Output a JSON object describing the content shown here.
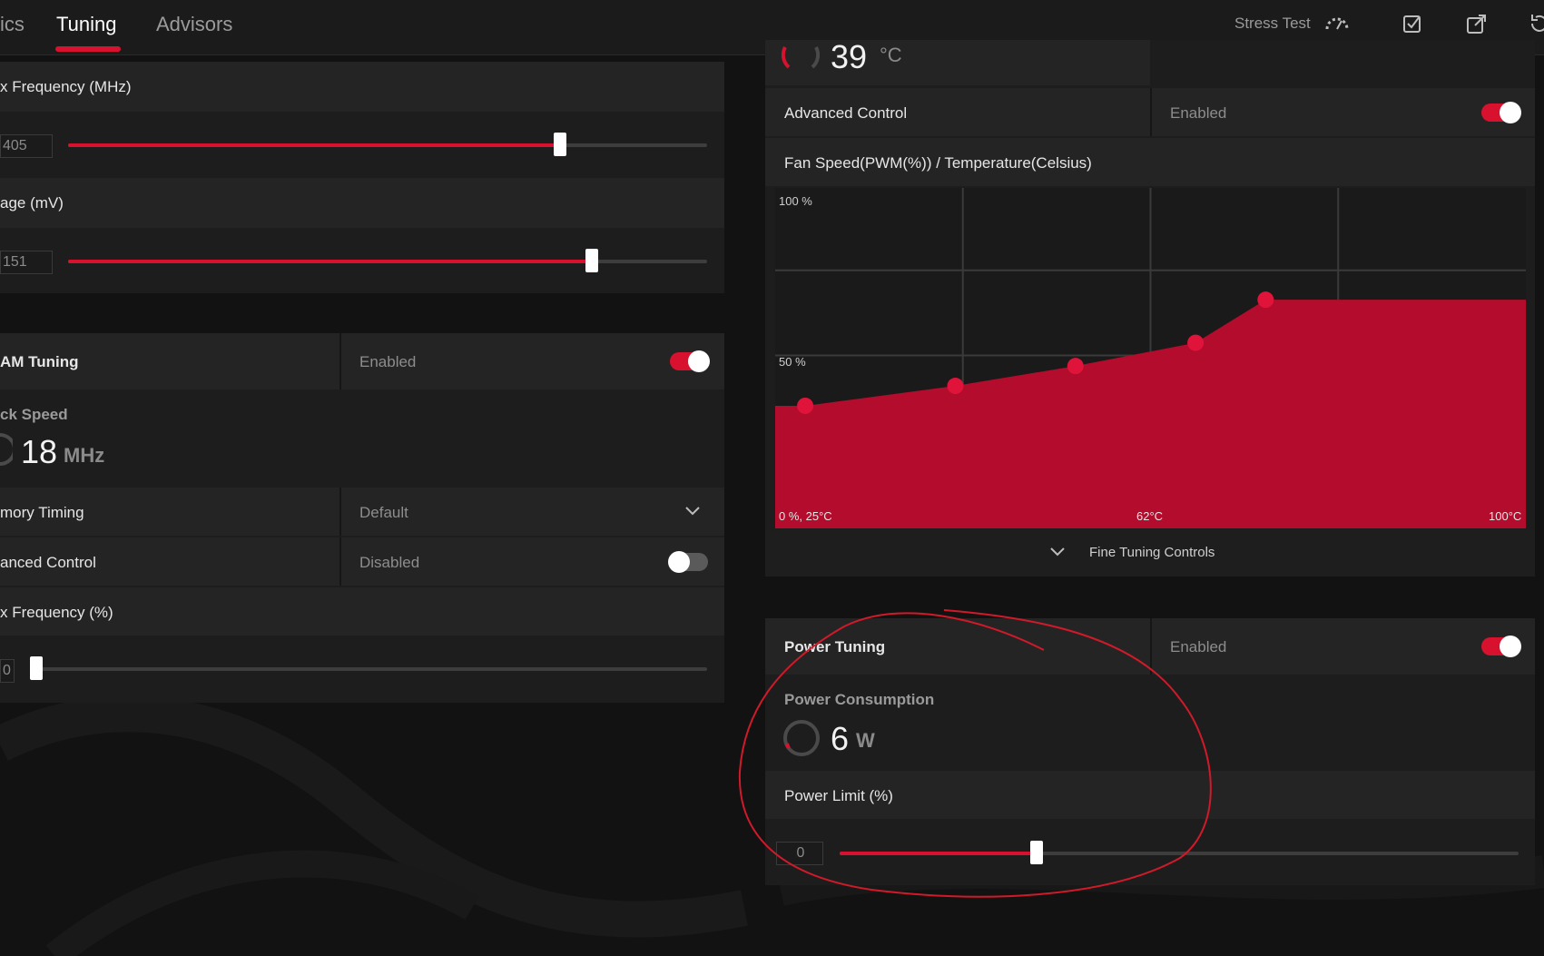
{
  "theme": {
    "accent": "#d8112e",
    "background": "#121212",
    "panel": "#1d1d1d",
    "row": "#242424"
  },
  "nav": {
    "partial_tab": "ics",
    "tabs": [
      {
        "label": "Tuning",
        "active": true
      },
      {
        "label": "Advisors",
        "active": false
      }
    ],
    "stress_test_label": "Stress Test",
    "icons": [
      "stress-gauge-icon",
      "checkbox-icon",
      "share-icon",
      "reset-icon"
    ]
  },
  "gpu_panel": {
    "max_freq_label": "x Frequency (MHz)",
    "max_freq_value": "405",
    "max_freq_level": 0.77,
    "voltage_label": "age (mV)",
    "voltage_value": "151",
    "voltage_level": 0.82
  },
  "vram_panel": {
    "title": "AM Tuning",
    "status": "Enabled",
    "enabled": true,
    "clock_speed_label": "ck Speed",
    "clock_speed_value": "18",
    "clock_speed_unit": "MHz",
    "memory_timing_label": "mory Timing",
    "memory_timing_value": "Default",
    "advanced_control_label": "anced Control",
    "advanced_control_status": "Disabled",
    "advanced_control_enabled": false,
    "max_freq_pct_label": "x Frequency (%)",
    "max_freq_pct_value": "0",
    "max_freq_pct_level": 0.0
  },
  "fan_panel": {
    "temperature_partial": "39",
    "temperature_unit": "°C",
    "advanced_control_label": "Advanced Control",
    "advanced_control_status": "Enabled",
    "advanced_control_enabled": true,
    "chart_title": "Fan Speed(PWM(%)) / Temperature(Celsius)",
    "fine_tuning_label": "Fine Tuning Controls"
  },
  "chart_data": {
    "type": "area",
    "title": "Fan Speed(PWM(%)) / Temperature(Celsius)",
    "xlim": [
      25,
      100
    ],
    "ylim": [
      0,
      100
    ],
    "y_tick_labels": [
      "100 %",
      "50 %"
    ],
    "x_tick_labels": [
      "0 %, 25°C",
      "62°C",
      "100°C"
    ],
    "grid": true,
    "series": [
      {
        "x": [
          28,
          43,
          55,
          67,
          74
        ],
        "y": [
          37,
          43,
          49,
          56,
          69
        ]
      }
    ]
  },
  "power_panel": {
    "title": "Power Tuning",
    "status": "Enabled",
    "enabled": true,
    "consumption_label": "Power Consumption",
    "consumption_value": "6",
    "consumption_unit": "W",
    "limit_label": "Power Limit (%)",
    "limit_value": "0",
    "limit_level": 0.29
  }
}
